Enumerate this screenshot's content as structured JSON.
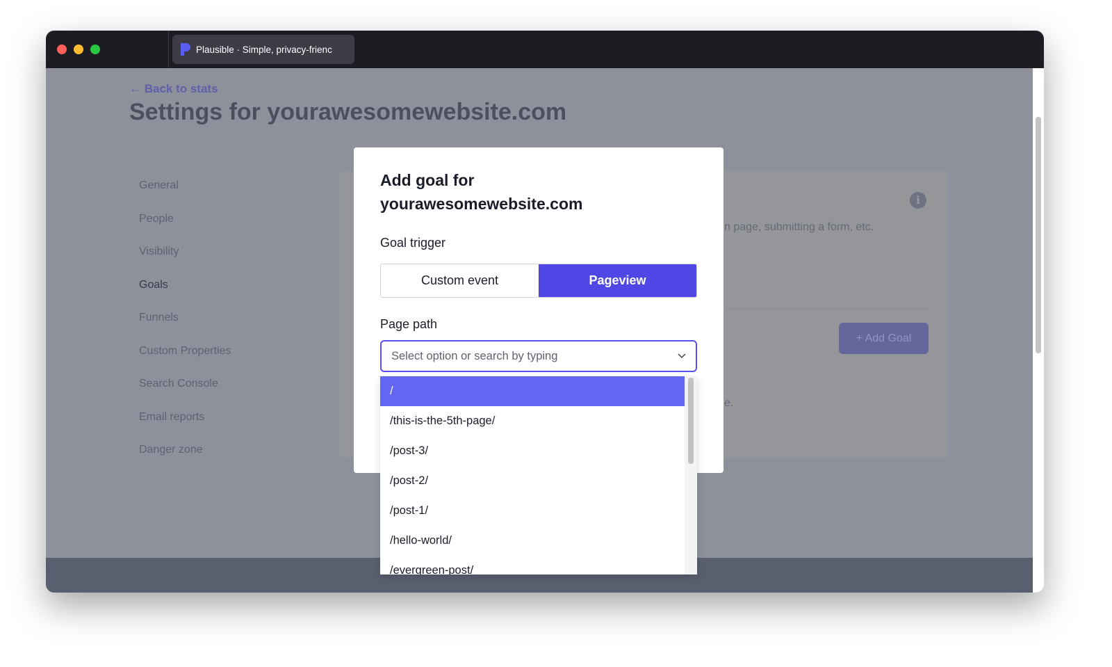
{
  "browser": {
    "tab_title": "Plausible · Simple, privacy-frienc",
    "traffic_lights": [
      "#fe5f57",
      "#febc2e",
      "#28c840"
    ]
  },
  "page": {
    "back_link": "← Back to stats",
    "title": "Settings for yourawesomewebsite.com"
  },
  "sidebar": {
    "items": [
      {
        "label": "General"
      },
      {
        "label": "People"
      },
      {
        "label": "Visibility"
      },
      {
        "label": "Goals",
        "active": true
      },
      {
        "label": "Funnels"
      },
      {
        "label": "Custom Properties"
      },
      {
        "label": "Search Console"
      },
      {
        "label": "Email reports"
      },
      {
        "label": "Danger zone"
      }
    ]
  },
  "card": {
    "description_fragment": "n page, submitting a form, etc.",
    "add_goal_label": "+ Add Goal",
    "fragment2": "e.",
    "info_icon": "info-icon"
  },
  "modal": {
    "title_line1": "Add goal for",
    "title_line2": "yourawesomewebsite.com",
    "trigger_label": "Goal trigger",
    "trigger_options": [
      "Custom event",
      "Pageview"
    ],
    "trigger_selected": "Pageview",
    "page_path_label": "Page path",
    "page_path_placeholder": "Select option or search by typing",
    "options": [
      "/",
      "/this-is-the-5th-page/",
      "/post-3/",
      "/post-2/",
      "/post-1/",
      "/hello-world/",
      "/evergreen-post/"
    ],
    "highlighted": "/"
  },
  "colors": {
    "accent": "#4f46e5",
    "highlight": "#6366f1"
  }
}
